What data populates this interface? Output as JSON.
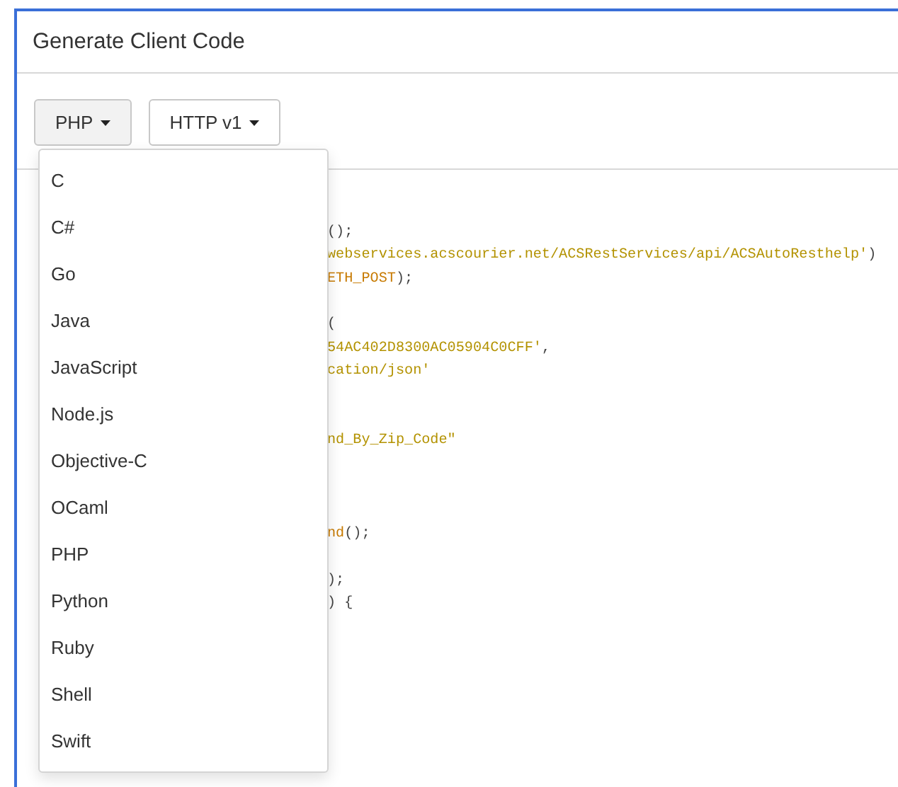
{
  "panel": {
    "title": "Generate Client Code"
  },
  "toolbar": {
    "buttons": [
      {
        "label": "PHP",
        "open": true
      },
      {
        "label": "HTTP v1",
        "open": false
      }
    ]
  },
  "language_menu": {
    "items": [
      {
        "label": "C"
      },
      {
        "label": "C#"
      },
      {
        "label": "Go"
      },
      {
        "label": "Java"
      },
      {
        "label": "JavaScript"
      },
      {
        "label": "Node.js"
      },
      {
        "label": "Objective-C"
      },
      {
        "label": "OCaml"
      },
      {
        "label": "PHP"
      },
      {
        "label": "Python"
      },
      {
        "label": "Ruby"
      },
      {
        "label": "Shell"
      },
      {
        "label": "Swift"
      }
    ]
  },
  "code": {
    "lines": [
      {
        "kind": "blank"
      },
      {
        "kind": "blank"
      },
      {
        "kind": "code",
        "segments": [
          {
            "kind": "plain",
            "text": "();"
          }
        ]
      },
      {
        "kind": "code",
        "segments": [
          {
            "kind": "string",
            "text": "webservices.acscourier.net/ACSRestServices/api/ACSAutoResthelp'"
          },
          {
            "kind": "plain",
            "text": ")"
          }
        ]
      },
      {
        "kind": "code",
        "segments": [
          {
            "kind": "name",
            "text": "ETH_POST"
          },
          {
            "kind": "plain",
            "text": ");"
          }
        ]
      },
      {
        "kind": "blank"
      },
      {
        "kind": "code",
        "segments": [
          {
            "kind": "plain",
            "text": "("
          }
        ]
      },
      {
        "kind": "code",
        "segments": [
          {
            "kind": "string",
            "text": "54AC402D8300AC05904C0CFF'"
          },
          {
            "kind": "plain",
            "text": ","
          }
        ]
      },
      {
        "kind": "code",
        "segments": [
          {
            "kind": "string",
            "text": "cation/json'"
          }
        ]
      },
      {
        "kind": "blank"
      },
      {
        "kind": "blank"
      },
      {
        "kind": "code",
        "segments": [
          {
            "kind": "string",
            "text": "nd_By_Zip_Code\""
          }
        ]
      },
      {
        "kind": "blank"
      },
      {
        "kind": "blank"
      },
      {
        "kind": "blank"
      },
      {
        "kind": "code",
        "segments": [
          {
            "kind": "name",
            "text": "nd"
          },
          {
            "kind": "plain",
            "text": "();"
          }
        ]
      },
      {
        "kind": "blank"
      },
      {
        "kind": "code",
        "segments": [
          {
            "kind": "plain",
            "text": ");"
          }
        ]
      },
      {
        "kind": "code",
        "segments": [
          {
            "kind": "plain",
            "text": ") {"
          }
        ]
      }
    ]
  }
}
